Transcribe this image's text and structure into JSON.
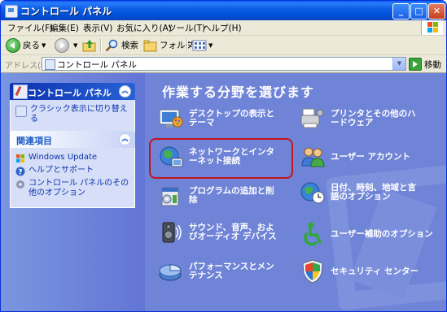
{
  "window": {
    "title": "コントロール パネル"
  },
  "menu": [
    "ファイル(F)",
    "編集(E)",
    "表示(V)",
    "お気に入り(A)",
    "ツール(T)",
    "ヘルプ(H)"
  ],
  "toolbar": {
    "back_label": "戻る",
    "search_label": "検索",
    "folder_label": "フォルダ"
  },
  "address": {
    "label": "アドレス(D)",
    "value": "コントロール パネル",
    "go_label": "移動"
  },
  "left_panels": {
    "main": {
      "title": "コントロール パネル",
      "links": [
        "クラシック表示に切り替える"
      ]
    },
    "related": {
      "title": "関連項目",
      "links": [
        "Windows Update",
        "ヘルプとサポート",
        "コントロール パネルのその他のオプション"
      ]
    }
  },
  "main": {
    "title": "作業する分野を選びます",
    "categories": [
      {
        "label": "デスクトップの表示とテーマ",
        "icon": "desktop-theme-icon"
      },
      {
        "label": "プリンタとその他のハードウェア",
        "icon": "printer-icon"
      },
      {
        "label": "ネットワークとインターネット接続",
        "icon": "network-icon"
      },
      {
        "label": "ユーザー アカウント",
        "icon": "users-icon"
      },
      {
        "label": "プログラムの追加と削除",
        "icon": "add-remove-programs-icon"
      },
      {
        "label": "日付、時刻、地域と言語のオプション",
        "icon": "globe-clock-icon"
      },
      {
        "label": "サウンド、音声、およびオーディオ デバイス",
        "icon": "speaker-icon"
      },
      {
        "label": "ユーザー補助のオプション",
        "icon": "accessibility-icon"
      },
      {
        "label": "パフォーマンスとメンテナンス",
        "icon": "performance-icon"
      },
      {
        "label": "セキュリティ センター",
        "icon": "security-shield-icon"
      }
    ],
    "highlighted_category": "ネットワークとインターネット接続"
  },
  "colors": {
    "title_bar": "#0a5bf2",
    "left_pane": "#7a96df",
    "right_pane": "#6f84d7",
    "highlight": "#c4141f"
  }
}
